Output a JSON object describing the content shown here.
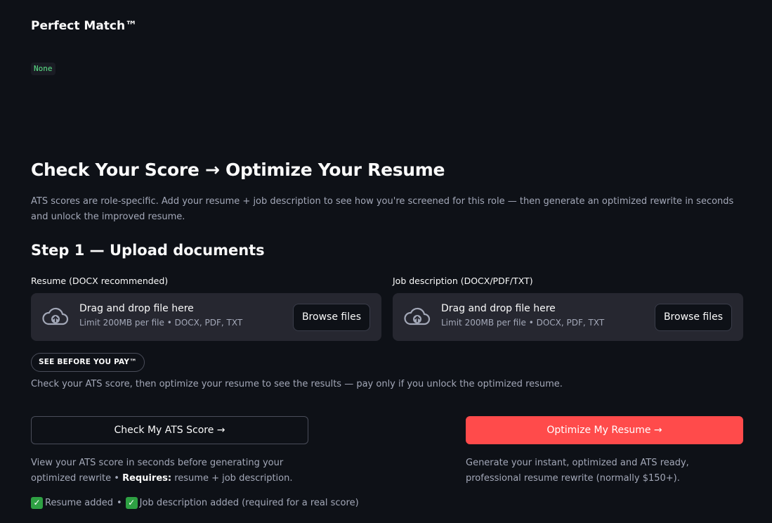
{
  "app": {
    "title": "Perfect Match™",
    "code_value": "None"
  },
  "hero": {
    "title": "Check Your Score → Optimize Your Resume",
    "description": "ATS scores are role-specific. Add your resume + job description to see how you're screened for this role — then generate an optimized rewrite in seconds and unlock the improved resume."
  },
  "step1": {
    "title": "Step 1 — Upload documents",
    "uploaders": [
      {
        "label": "Resume (DOCX recommended)",
        "drop_text": "Drag and drop file here",
        "limit_text": "Limit 200MB per file • DOCX, PDF, TXT",
        "button_label": "Browse files",
        "icon": "cloud-upload-icon"
      },
      {
        "label": "Job description (DOCX/PDF/TXT)",
        "drop_text": "Drag and drop file here",
        "limit_text": "Limit 200MB per file • DOCX, PDF, TXT",
        "button_label": "Browse files",
        "icon": "cloud-upload-icon"
      }
    ]
  },
  "badge": {
    "label": "SEE BEFORE YOU PAY™",
    "description": "Check your ATS score, then optimize your resume to see the results — pay only if you unlock the optimized resume."
  },
  "actions": {
    "check": {
      "label": "Check My ATS Score →",
      "description_pre": "View your ATS score in seconds before generating your optimized rewrite • ",
      "requires_label": "Requires:",
      "requires_text": " resume + job description."
    },
    "optimize": {
      "label": "Optimize My Resume →",
      "description": "Generate your instant, optimized and ATS ready, professional resume rewrite (normally $150+)."
    }
  },
  "status": {
    "resume_added": "Resume added",
    "separator": "•",
    "jd_added": "Job description added (required for a real score)"
  },
  "colors": {
    "background": "#0e1117",
    "surface": "#262730",
    "accent_red": "#ff4b4b",
    "code_green": "#5ce488",
    "check_green": "#2ea043"
  }
}
